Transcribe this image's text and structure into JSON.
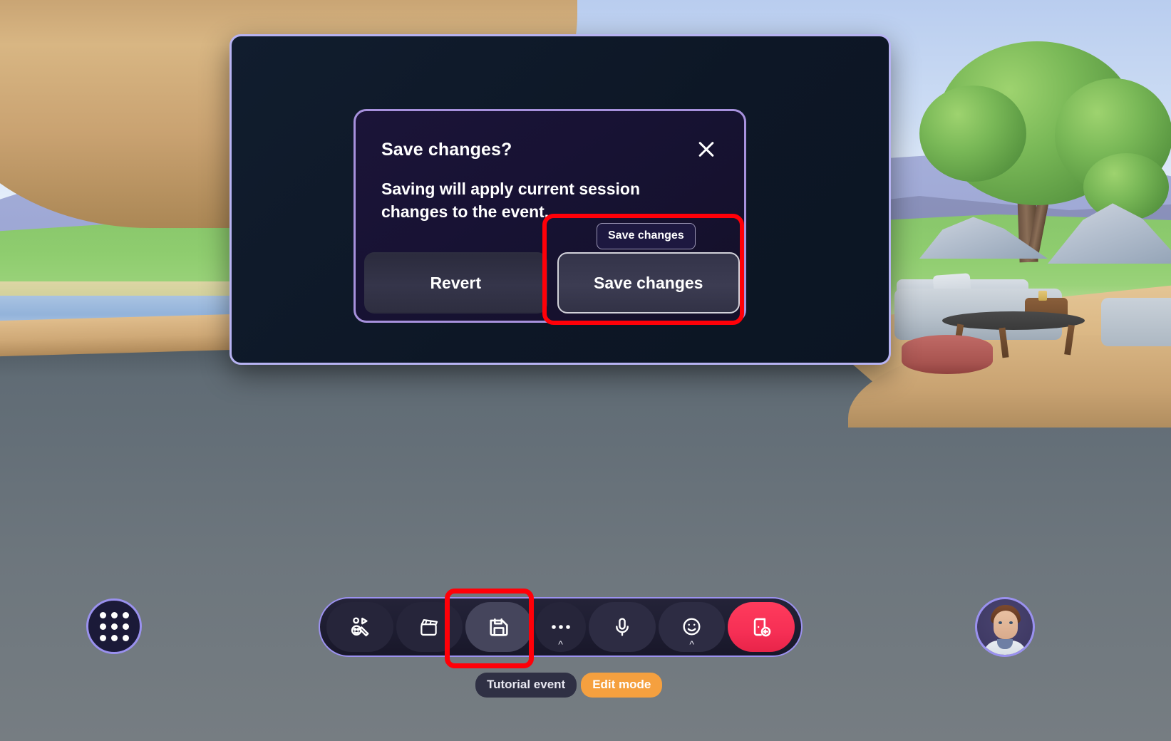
{
  "scene": {
    "name": "virtual-event-space",
    "description": "Immersive 3D virtual venue with wooden archway, meadow, tree and lounge furniture"
  },
  "editor_panel": {
    "name": "event-editor-panel"
  },
  "dialog": {
    "title": "Save changes?",
    "body": "Saving will apply current session changes to the event.",
    "close_label": "Close",
    "buttons": [
      {
        "label": "Revert",
        "style": "secondary"
      },
      {
        "label": "Save changes",
        "style": "primary"
      }
    ]
  },
  "tooltip": {
    "text": "Save changes"
  },
  "toolbar": {
    "items": [
      {
        "icon": "reactions-icon",
        "label": "Reactions"
      },
      {
        "icon": "clapperboard-icon",
        "label": "Scene"
      },
      {
        "icon": "save-floppy-icon",
        "label": "Save"
      },
      {
        "icon": "more-ellipsis-icon",
        "label": "More"
      },
      {
        "icon": "microphone-icon",
        "label": "Mic"
      },
      {
        "icon": "emoji-smiley-icon",
        "label": "Emoji"
      },
      {
        "icon": "leave-door-icon",
        "label": "Leave"
      }
    ]
  },
  "apps_button": {
    "icon": "app-grid-icon",
    "label": "Apps"
  },
  "avatar": {
    "icon": "avatar-icon",
    "label": "Your avatar"
  },
  "status": {
    "event_name": "Tutorial event",
    "mode": "Edit mode"
  },
  "highlights": [
    {
      "name": "save-changes-dialog-highlight",
      "color": "#ff0008"
    },
    {
      "name": "save-toolbar-button-highlight",
      "color": "#ff0008"
    }
  ],
  "colors": {
    "accent_purple": "#9a91ef",
    "dialog_border": "#a791dd",
    "panel_bg": "#0d1726",
    "dialog_bg": "#171233",
    "danger_red": "#ff3b5c",
    "highlight_red": "#ff0008",
    "edit_mode_amber": "#f5a03f"
  }
}
